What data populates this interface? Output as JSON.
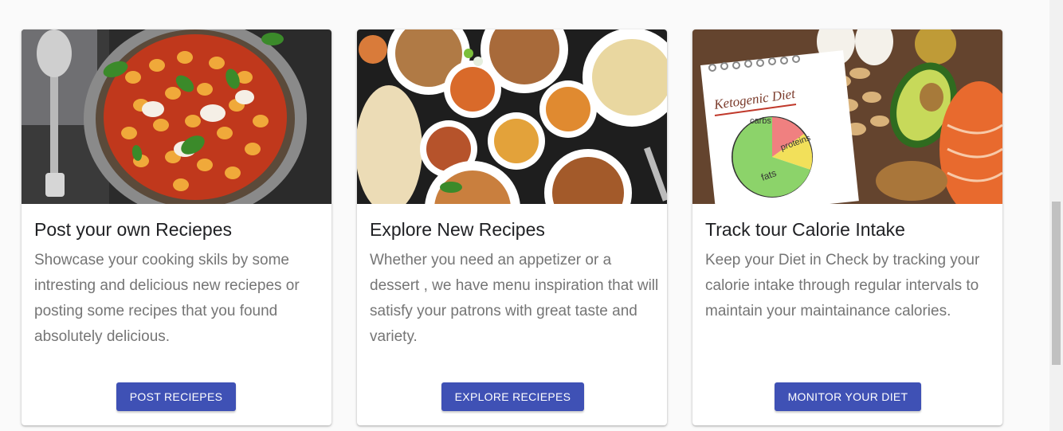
{
  "cards": [
    {
      "title": "Post your own Reciepes",
      "description": "Showcase your cooking skils by some intresting and delicious new reciepes or posting some recipes that you found absolutely delicious.",
      "button_label": "POST RECIEPES",
      "image_subject": "gnocchi-pan-icon"
    },
    {
      "title": "Explore New Recipes",
      "description": "Whether you need an appetizer or a dessert , we have menu inspiration that will satisfy your patrons with great taste and variety.",
      "button_label": "EXPLORE RECIEPES",
      "image_subject": "indian-dishes-icon"
    },
    {
      "title": "Track tour Calorie Intake",
      "description": "Keep your Diet in Check by tracking your calorie intake through regular intervals to maintain your maintainance calories.",
      "button_label": "MONITOR YOUR DIET",
      "image_subject": "keto-notebook-icon",
      "notebook": {
        "heading": "Ketogenic Diet",
        "labels": [
          "carbs",
          "proteins",
          "fats"
        ]
      }
    }
  ],
  "colors": {
    "button": "#3f51b5",
    "title": "#202124",
    "description": "#757575",
    "background": "#fafafa"
  }
}
